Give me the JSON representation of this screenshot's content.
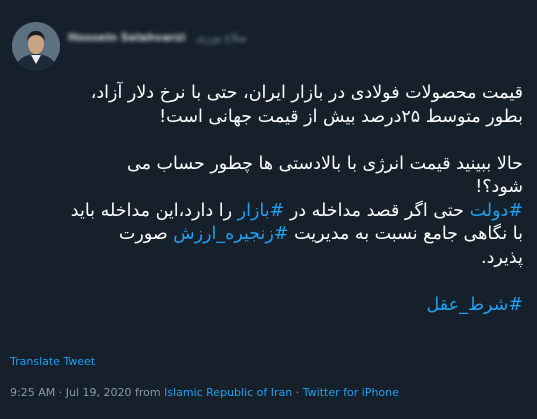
{
  "author": {
    "name": "Hossein Selahvarzi",
    "handle": "سلاح ورزی"
  },
  "tweet": {
    "segments": [
      [
        {
          "t": "قیمت محصولات فولادی در  بازار ایران، حتی با نرخ دلار آزاد،"
        }
      ],
      [
        {
          "t": "بطور متوسط ۲۵درصد بیش از قیمت جهانی است!"
        }
      ],
      [],
      [
        {
          "t": "حالا ببینید قیمت انرژی با بالادستی ها چطور حساب می"
        }
      ],
      [
        {
          "t": "شود؟!"
        }
      ],
      [
        {
          "h": "#دولت"
        },
        {
          "t": " حتی اگر قصد مداخله در "
        },
        {
          "h": "#بازار"
        },
        {
          "t": " را دارد،این مداخله باید"
        }
      ],
      [
        {
          "t": "با نگاهی جامع نسبت به مدیریت "
        },
        {
          "h": "#زنجیره_ارزش"
        },
        {
          "t": " صورت"
        }
      ],
      [
        {
          "t": "پذیرد."
        }
      ],
      [],
      [
        {
          "h": "#شرط_عقل"
        }
      ]
    ]
  },
  "translate_label": "Translate Tweet",
  "meta": {
    "time": "9:25 AM",
    "sep1": " · ",
    "date": "Jul 19, 2020",
    "from": " from ",
    "location": "Islamic Republic of Iran",
    "sep2": " · ",
    "source": "Twitter for iPhone"
  },
  "colors": {
    "background": "#15202b",
    "link": "#1da1f2",
    "muted": "#8899a6"
  }
}
